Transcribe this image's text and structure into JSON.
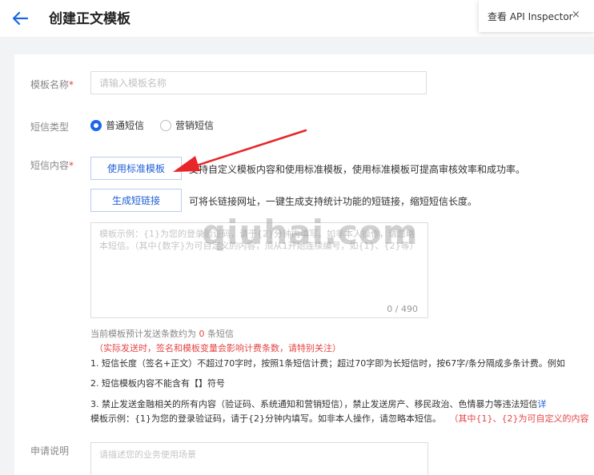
{
  "header": {
    "title": "创建正文模板",
    "api_popover_label": "查看 API Inspector",
    "close_glyph": "×"
  },
  "form": {
    "name_label": "模板名称",
    "name_placeholder": "请输入模板名称",
    "type_label": "短信类型",
    "type_options": [
      "普通短信",
      "营销短信"
    ],
    "type_selected": "普通短信",
    "content_label": "短信内容",
    "required_mark": "*",
    "use_template_button": "使用标准模板",
    "use_template_hint": "支持自定义模板内容和使用标准模板，使用标准模板可提高审核效率和成功率。",
    "short_link_button": "生成短链接",
    "short_link_hint": "可将长链接网址，一键生成支持统计功能的短链接，缩短短信长度。",
    "content_placeholder": "模板示例：{1}为您的登录验证码，请于{2}分钟内填写。如非本人操作，请忽略本短信。（其中{数字}为可自定义的内容，须从1开始连续编号，如{1}、{2}等）",
    "char_counter": "0 / 490",
    "estimate_prefix": "当前模板预计发送条数约为",
    "estimate_count": "0",
    "estimate_suffix": "条短信",
    "estimate_warning": "（实际发送时，签名和模板变量会影响计费条数，请特别关注）",
    "rules": [
      "1. 短信长度（签名+正文）不超过70字时，按照1条短信计费；超过70字即为长短信时，按67字/条分隔成多条计费。例如",
      "2. 短信模板内容不能含有【】符号",
      "3. 禁止发送金融相关的所有内容（验证码、系统通知和营销短信），禁止发送房产、移民政治、色情暴力等违法短信"
    ],
    "rule3_link": "详",
    "example_text": "模板示例：{1}为您的登录验证码，请于{2}分钟内填写。如非本人操作，请忽略本短信。",
    "example_note": "（其中{1}、{2}为可自定义的内容",
    "apply_label": "申请说明",
    "apply_placeholder": "请描述您的业务使用场景"
  },
  "watermark": "qiuhai.com",
  "colors": {
    "primary": "#1b66e8",
    "required": "#e54545",
    "annotation_arrow": "#e8262a"
  }
}
